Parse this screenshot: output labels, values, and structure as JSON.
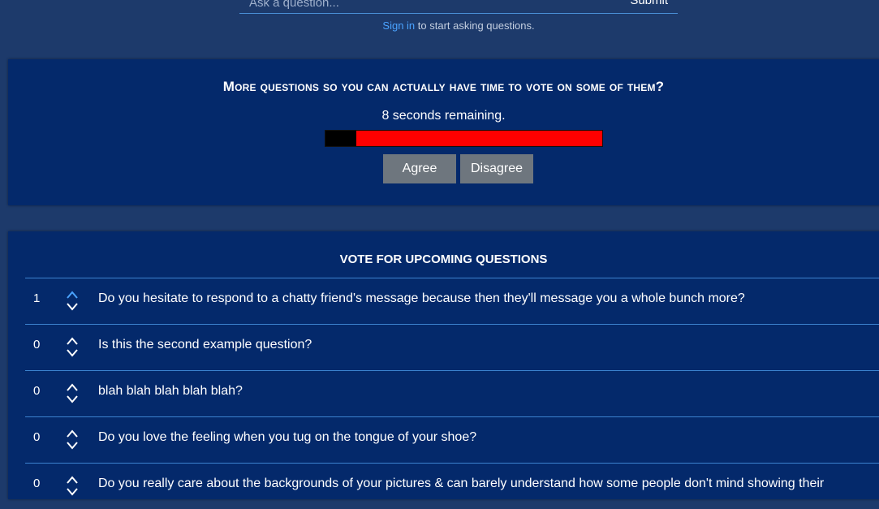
{
  "ask": {
    "placeholder": "Ask a question...",
    "submit_label": "Submit"
  },
  "signin": {
    "link_label": "Sign in",
    "rest": " to start asking questions."
  },
  "current_question": {
    "title": "More questions so you can actually have time to vote on some of them?",
    "timer_text": "8 seconds remaining.",
    "time_elapsed_fraction": 0.11,
    "agree_label": "Agree",
    "disagree_label": "Disagree"
  },
  "upcoming": {
    "title": "VOTE FOR UPCOMING QUESTIONS",
    "questions": [
      {
        "score": "1",
        "text": "Do you hesitate to respond to a chatty friend's message because then they'll message you a whole bunch more?",
        "upvoted": true
      },
      {
        "score": "0",
        "text": "Is this the second example question?",
        "upvoted": false
      },
      {
        "score": "0",
        "text": "blah blah blah blah blah?",
        "upvoted": false
      },
      {
        "score": "0",
        "text": "Do you love the feeling when you tug on the tongue of your shoe?",
        "upvoted": false
      },
      {
        "score": "0",
        "text": "Do you really care about the backgrounds of your pictures & can barely understand how some people don't mind showing their",
        "upvoted": false
      }
    ]
  },
  "colors": {
    "page_background": "#1d3a6b",
    "panel_background": "#04296b",
    "accent_blue": "#4aa3ff",
    "timer_remaining": "#ff0000",
    "timer_elapsed": "#000000",
    "button_gray": "#6e767e"
  },
  "icons": {
    "upvote": "chevron-up-icon",
    "downvote": "chevron-down-icon"
  }
}
